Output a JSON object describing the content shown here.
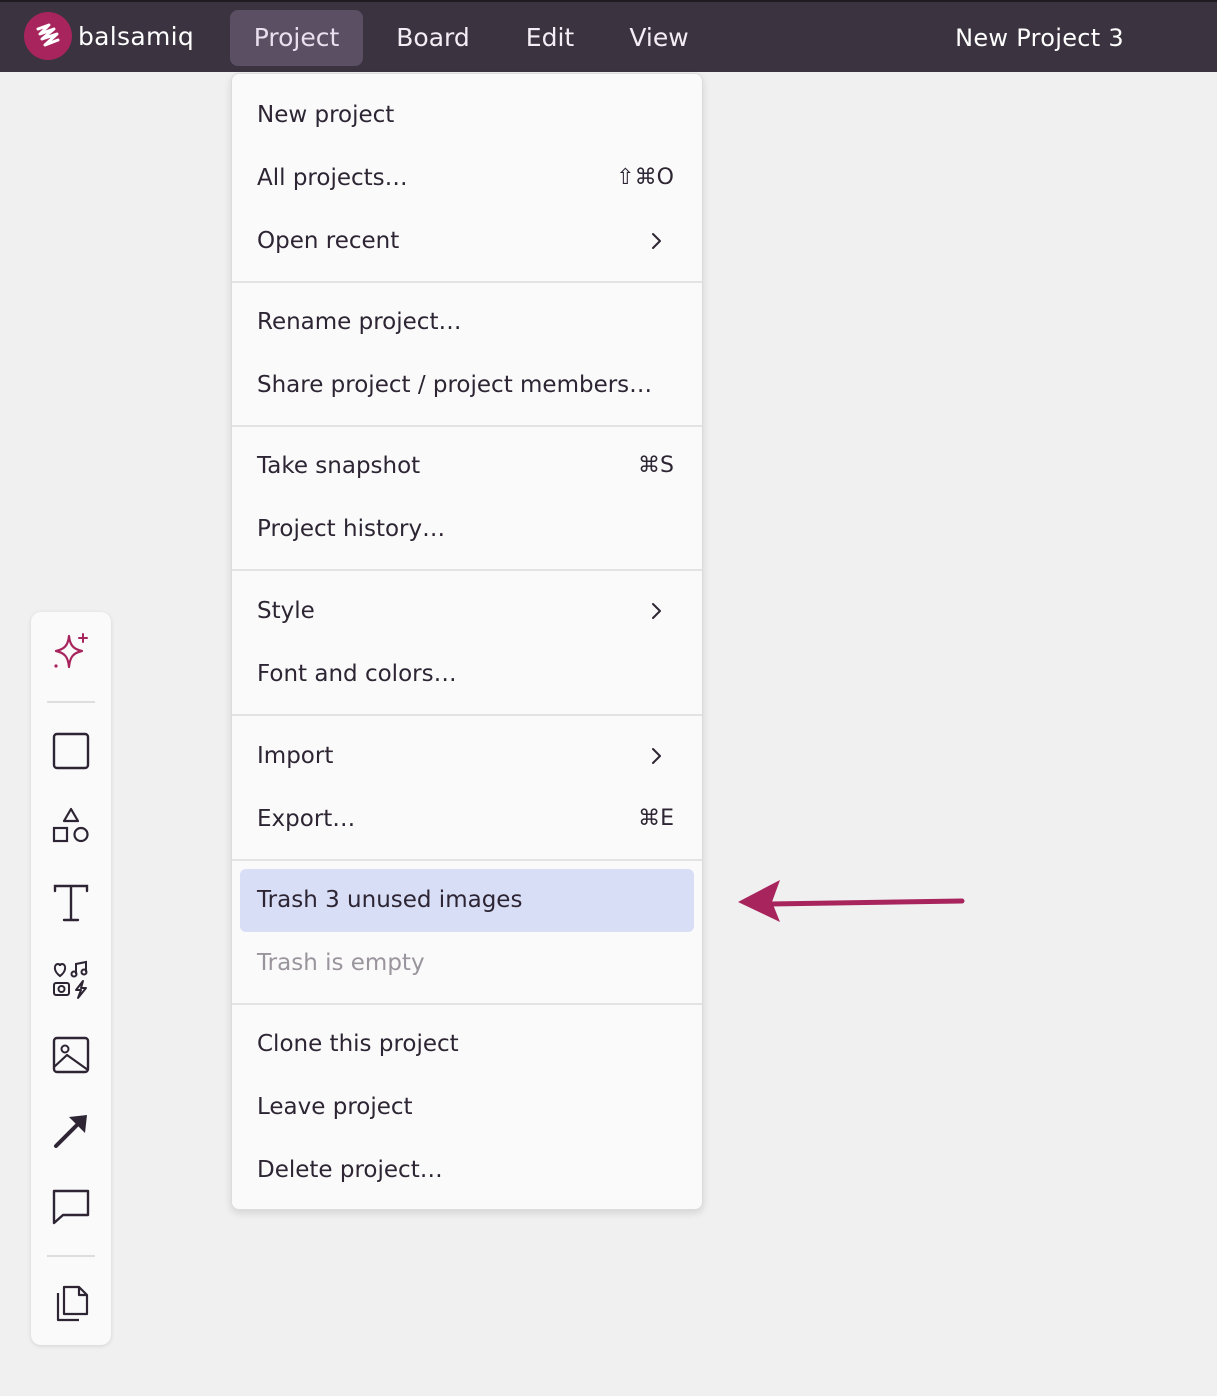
{
  "app": {
    "name": "balsamiq",
    "brand_color": "#a8245d",
    "topbar_color": "#3b333f"
  },
  "menubar": {
    "items": [
      {
        "label": "Project",
        "active": true
      },
      {
        "label": "Board",
        "active": false
      },
      {
        "label": "Edit",
        "active": false
      },
      {
        "label": "View",
        "active": false
      }
    ],
    "project_title": "New Project 3"
  },
  "dropdown": {
    "items": [
      {
        "label": "New project",
        "shortcut": "",
        "submenu": false
      },
      {
        "label": "All projects…",
        "shortcut": "⇧⌘O",
        "submenu": false
      },
      {
        "label": "Open recent",
        "shortcut": "",
        "submenu": true
      },
      {
        "label": "Rename project…",
        "shortcut": "",
        "submenu": false
      },
      {
        "label": "Share project / project members…",
        "shortcut": "",
        "submenu": false
      },
      {
        "label": "Take snapshot",
        "shortcut": "⌘S",
        "submenu": false
      },
      {
        "label": "Project history…",
        "shortcut": "",
        "submenu": false
      },
      {
        "label": "Style",
        "shortcut": "",
        "submenu": true
      },
      {
        "label": "Font and colors…",
        "shortcut": "",
        "submenu": false
      },
      {
        "label": "Import",
        "shortcut": "",
        "submenu": true
      },
      {
        "label": "Export…",
        "shortcut": "⌘E",
        "submenu": false
      },
      {
        "label": "Trash 3 unused images",
        "shortcut": "",
        "submenu": false,
        "highlighted": true
      },
      {
        "label": "Trash is empty",
        "shortcut": "",
        "submenu": false,
        "disabled": true
      },
      {
        "label": "Clone this project",
        "shortcut": "",
        "submenu": false
      },
      {
        "label": "Leave project",
        "shortcut": "",
        "submenu": false
      },
      {
        "label": "Delete project…",
        "shortcut": "",
        "submenu": false
      }
    ],
    "highlight_color": "#d8def6"
  },
  "annotation": {
    "arrow_color": "#a8245d"
  },
  "toolbar": {
    "tools": [
      "ai-sparkle-icon",
      "rectangle-icon",
      "shapes-icon",
      "text-icon",
      "icons-library-icon",
      "image-icon",
      "arrow-icon",
      "comment-icon",
      "duplicate-icon"
    ]
  }
}
